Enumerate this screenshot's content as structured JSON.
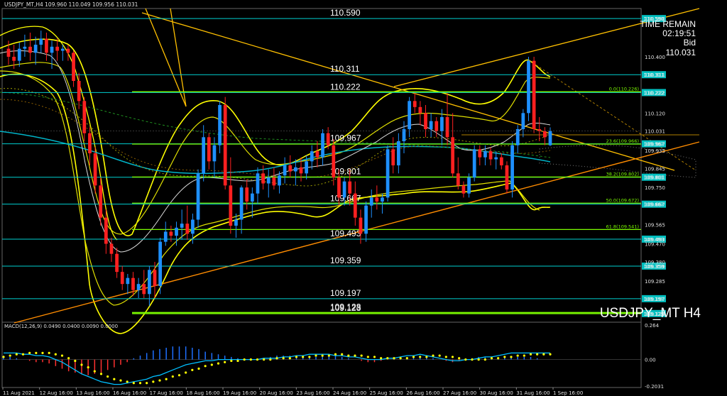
{
  "header": {
    "symbol_line": "USDJPY_MT,H4 109.960 110.049 109.956 110.031"
  },
  "watermark": "USDJPY_MT H4",
  "timer": {
    "label": "TIME REMAIN",
    "value": "02:19:51",
    "bid_label": "Bid",
    "bid_value": "110.031"
  },
  "colors": {
    "bull": "#1e90ff",
    "bear": "#ff2020",
    "hline": "#00cfd0",
    "fib": "#7cfc00",
    "band": "#ffff00",
    "trend": "#ffc000",
    "orange": "#ff8c00",
    "macd_line": "#00bfff",
    "signal": "#ffff00",
    "macd_neg": "#ff3030",
    "macd_pos": "#1e6fff"
  },
  "chart_data": [
    {
      "type": "candlestick",
      "title": "USDJPY_MT,H4",
      "ylim": [
        109.08,
        110.64
      ],
      "y_ticks": [
        "110.590",
        "110.400",
        "110.311",
        "110.222",
        "110.120",
        "110.031",
        "109.935",
        "109.967",
        "109.845",
        "109.801",
        "109.750",
        "109.667",
        "109.565",
        "109.493",
        "109.470",
        "109.380",
        "109.359",
        "109.285",
        "109.197",
        "109.123"
      ],
      "x_ticks": [
        "11 Aug 2021",
        "12 Aug 16:00",
        "13 Aug 16:00",
        "16 Aug 16:00",
        "17 Aug 16:00",
        "18 Aug 16:00",
        "19 Aug 16:00",
        "20 Aug 16:00",
        "23 Aug 16:00",
        "24 Aug 16:00",
        "25 Aug 16:00",
        "26 Aug 16:00",
        "27 Aug 16:00",
        "30 Aug 16:00",
        "31 Aug 16:00",
        "1 Sep 16:00"
      ],
      "horizontal_levels": [
        {
          "label": "110.590",
          "value": 110.59,
          "box": "110.590"
        },
        {
          "label": "110.311",
          "value": 110.311,
          "box": "110.311"
        },
        {
          "label": "110.222",
          "value": 110.222,
          "box": "110.222"
        },
        {
          "label": "109.967",
          "value": 109.967,
          "box": "109.967"
        },
        {
          "label": "109.801",
          "value": 109.801,
          "box": "109.801"
        },
        {
          "label": "109.667",
          "value": 109.667,
          "box": "109.667"
        },
        {
          "label": "109.493",
          "value": 109.493,
          "box": "109.493"
        },
        {
          "label": "109.359",
          "value": 109.359,
          "box": "109.359"
        },
        {
          "label": "109.197",
          "value": 109.197,
          "box": "109.197"
        },
        {
          "label": "109.128",
          "value": 109.128,
          "box": ""
        },
        {
          "label": "109.123",
          "value": 109.123,
          "box": "109.123"
        }
      ],
      "fib_levels": [
        {
          "label": "0.0(110.226)",
          "value": 110.226
        },
        {
          "label": "23.6(109.966)",
          "value": 109.966
        },
        {
          "label": "38.2(109.802)",
          "value": 109.802
        },
        {
          "label": "50.0(109.672)",
          "value": 109.672
        },
        {
          "label": "61.8(109.541)",
          "value": 109.541
        }
      ],
      "candles": [
        {
          "o": 110.44,
          "h": 110.48,
          "l": 110.36,
          "c": 110.4
        },
        {
          "o": 110.4,
          "h": 110.46,
          "l": 110.34,
          "c": 110.38
        },
        {
          "o": 110.38,
          "h": 110.47,
          "l": 110.35,
          "c": 110.44
        },
        {
          "o": 110.44,
          "h": 110.51,
          "l": 110.4,
          "c": 110.45
        },
        {
          "o": 110.45,
          "h": 110.52,
          "l": 110.38,
          "c": 110.42
        },
        {
          "o": 110.42,
          "h": 110.5,
          "l": 110.36,
          "c": 110.46
        },
        {
          "o": 110.46,
          "h": 110.53,
          "l": 110.42,
          "c": 110.49
        },
        {
          "o": 110.49,
          "h": 110.52,
          "l": 110.38,
          "c": 110.42
        },
        {
          "o": 110.42,
          "h": 110.48,
          "l": 110.34,
          "c": 110.45
        },
        {
          "o": 110.45,
          "h": 110.49,
          "l": 110.38,
          "c": 110.43
        },
        {
          "o": 110.43,
          "h": 110.46,
          "l": 110.38,
          "c": 110.44
        },
        {
          "o": 110.44,
          "h": 110.46,
          "l": 110.38,
          "c": 110.42
        },
        {
          "o": 110.42,
          "h": 110.43,
          "l": 110.25,
          "c": 110.28
        },
        {
          "o": 110.28,
          "h": 110.32,
          "l": 110.14,
          "c": 110.18
        },
        {
          "o": 110.18,
          "h": 110.2,
          "l": 109.98,
          "c": 110.02
        },
        {
          "o": 110.02,
          "h": 110.05,
          "l": 109.86,
          "c": 109.92
        },
        {
          "o": 109.92,
          "h": 109.95,
          "l": 109.72,
          "c": 109.76
        },
        {
          "o": 109.76,
          "h": 109.8,
          "l": 109.56,
          "c": 109.6
        },
        {
          "o": 109.6,
          "h": 109.64,
          "l": 109.42,
          "c": 109.47
        },
        {
          "o": 109.47,
          "h": 109.5,
          "l": 109.38,
          "c": 109.42
        },
        {
          "o": 109.42,
          "h": 109.45,
          "l": 109.3,
          "c": 109.33
        },
        {
          "o": 109.33,
          "h": 109.36,
          "l": 109.24,
          "c": 109.27
        },
        {
          "o": 109.27,
          "h": 109.32,
          "l": 109.22,
          "c": 109.3
        },
        {
          "o": 109.3,
          "h": 109.33,
          "l": 109.21,
          "c": 109.24
        },
        {
          "o": 109.24,
          "h": 109.3,
          "l": 109.2,
          "c": 109.27
        },
        {
          "o": 109.27,
          "h": 109.34,
          "l": 109.2,
          "c": 109.22
        },
        {
          "o": 109.22,
          "h": 109.36,
          "l": 109.16,
          "c": 109.34
        },
        {
          "o": 109.34,
          "h": 109.38,
          "l": 109.2,
          "c": 109.26
        },
        {
          "o": 109.26,
          "h": 109.5,
          "l": 109.22,
          "c": 109.48
        },
        {
          "o": 109.48,
          "h": 109.58,
          "l": 109.46,
          "c": 109.53
        },
        {
          "o": 109.53,
          "h": 109.56,
          "l": 109.48,
          "c": 109.51
        },
        {
          "o": 109.51,
          "h": 109.58,
          "l": 109.46,
          "c": 109.55
        },
        {
          "o": 109.55,
          "h": 109.64,
          "l": 109.49,
          "c": 109.57
        },
        {
          "o": 109.57,
          "h": 109.66,
          "l": 109.49,
          "c": 109.52
        },
        {
          "o": 109.52,
          "h": 109.62,
          "l": 109.47,
          "c": 109.59
        },
        {
          "o": 109.59,
          "h": 109.84,
          "l": 109.55,
          "c": 109.82
        },
        {
          "o": 109.82,
          "h": 110.06,
          "l": 109.78,
          "c": 110.0
        },
        {
          "o": 110.0,
          "h": 110.02,
          "l": 109.84,
          "c": 109.88
        },
        {
          "o": 109.88,
          "h": 110.0,
          "l": 109.8,
          "c": 109.96
        },
        {
          "o": 109.96,
          "h": 110.18,
          "l": 109.92,
          "c": 110.16
        },
        {
          "o": 110.16,
          "h": 110.2,
          "l": 109.74,
          "c": 109.76
        },
        {
          "o": 109.76,
          "h": 109.9,
          "l": 109.52,
          "c": 109.56
        },
        {
          "o": 109.56,
          "h": 109.62,
          "l": 109.5,
          "c": 109.59
        },
        {
          "o": 109.59,
          "h": 109.76,
          "l": 109.52,
          "c": 109.75
        },
        {
          "o": 109.75,
          "h": 109.79,
          "l": 109.64,
          "c": 109.68
        },
        {
          "o": 109.68,
          "h": 109.75,
          "l": 109.6,
          "c": 109.72
        },
        {
          "o": 109.72,
          "h": 109.85,
          "l": 109.67,
          "c": 109.82
        },
        {
          "o": 109.82,
          "h": 109.86,
          "l": 109.74,
          "c": 109.77
        },
        {
          "o": 109.77,
          "h": 109.84,
          "l": 109.7,
          "c": 109.8
        },
        {
          "o": 109.8,
          "h": 109.85,
          "l": 109.74,
          "c": 109.76
        },
        {
          "o": 109.76,
          "h": 109.83,
          "l": 109.72,
          "c": 109.81
        },
        {
          "o": 109.81,
          "h": 109.9,
          "l": 109.77,
          "c": 109.86
        },
        {
          "o": 109.86,
          "h": 109.91,
          "l": 109.8,
          "c": 109.83
        },
        {
          "o": 109.83,
          "h": 109.89,
          "l": 109.76,
          "c": 109.85
        },
        {
          "o": 109.85,
          "h": 109.9,
          "l": 109.78,
          "c": 109.82
        },
        {
          "o": 109.82,
          "h": 109.91,
          "l": 109.79,
          "c": 109.88
        },
        {
          "o": 109.88,
          "h": 109.96,
          "l": 109.84,
          "c": 109.93
        },
        {
          "o": 109.93,
          "h": 109.98,
          "l": 109.85,
          "c": 109.9
        },
        {
          "o": 109.9,
          "h": 110.04,
          "l": 109.86,
          "c": 110.02
        },
        {
          "o": 110.02,
          "h": 110.05,
          "l": 109.94,
          "c": 109.96
        },
        {
          "o": 109.96,
          "h": 109.99,
          "l": 109.76,
          "c": 109.8
        },
        {
          "o": 109.8,
          "h": 109.84,
          "l": 109.66,
          "c": 109.7
        },
        {
          "o": 109.7,
          "h": 109.8,
          "l": 109.66,
          "c": 109.78
        },
        {
          "o": 109.78,
          "h": 109.84,
          "l": 109.66,
          "c": 109.72
        },
        {
          "o": 109.72,
          "h": 109.78,
          "l": 109.56,
          "c": 109.6
        },
        {
          "o": 109.6,
          "h": 109.64,
          "l": 109.47,
          "c": 109.52
        },
        {
          "o": 109.52,
          "h": 109.68,
          "l": 109.48,
          "c": 109.66
        },
        {
          "o": 109.66,
          "h": 109.74,
          "l": 109.6,
          "c": 109.7
        },
        {
          "o": 109.7,
          "h": 109.76,
          "l": 109.64,
          "c": 109.68
        },
        {
          "o": 109.68,
          "h": 109.72,
          "l": 109.62,
          "c": 109.7
        },
        {
          "o": 109.7,
          "h": 109.96,
          "l": 109.68,
          "c": 109.94
        },
        {
          "o": 109.94,
          "h": 110.0,
          "l": 109.82,
          "c": 109.86
        },
        {
          "o": 109.86,
          "h": 110.02,
          "l": 109.82,
          "c": 109.98
        },
        {
          "o": 109.98,
          "h": 110.08,
          "l": 109.92,
          "c": 110.04
        },
        {
          "o": 110.04,
          "h": 110.2,
          "l": 110.0,
          "c": 110.18
        },
        {
          "o": 110.18,
          "h": 110.22,
          "l": 110.12,
          "c": 110.15
        },
        {
          "o": 110.15,
          "h": 110.18,
          "l": 110.06,
          "c": 110.12
        },
        {
          "o": 110.12,
          "h": 110.16,
          "l": 110.0,
          "c": 110.04
        },
        {
          "o": 110.04,
          "h": 110.12,
          "l": 110.0,
          "c": 110.08
        },
        {
          "o": 110.08,
          "h": 110.1,
          "l": 110.0,
          "c": 110.03
        },
        {
          "o": 110.03,
          "h": 110.14,
          "l": 109.96,
          "c": 110.1
        },
        {
          "o": 110.1,
          "h": 110.22,
          "l": 109.96,
          "c": 110.0
        },
        {
          "o": 110.0,
          "h": 110.12,
          "l": 109.8,
          "c": 109.82
        },
        {
          "o": 109.82,
          "h": 109.9,
          "l": 109.74,
          "c": 109.76
        },
        {
          "o": 109.76,
          "h": 109.78,
          "l": 109.7,
          "c": 109.72
        },
        {
          "o": 109.72,
          "h": 109.82,
          "l": 109.7,
          "c": 109.8
        },
        {
          "o": 109.8,
          "h": 109.96,
          "l": 109.78,
          "c": 109.94
        },
        {
          "o": 109.94,
          "h": 109.96,
          "l": 109.86,
          "c": 109.9
        },
        {
          "o": 109.9,
          "h": 109.96,
          "l": 109.86,
          "c": 109.93
        },
        {
          "o": 109.93,
          "h": 109.95,
          "l": 109.86,
          "c": 109.89
        },
        {
          "o": 109.89,
          "h": 109.93,
          "l": 109.84,
          "c": 109.9
        },
        {
          "o": 109.9,
          "h": 109.92,
          "l": 109.84,
          "c": 109.86
        },
        {
          "o": 109.86,
          "h": 109.88,
          "l": 109.72,
          "c": 109.74
        },
        {
          "o": 109.74,
          "h": 109.98,
          "l": 109.7,
          "c": 109.96
        },
        {
          "o": 109.96,
          "h": 110.06,
          "l": 109.92,
          "c": 110.04
        },
        {
          "o": 110.04,
          "h": 110.14,
          "l": 110.0,
          "c": 110.12
        },
        {
          "o": 110.12,
          "h": 110.4,
          "l": 110.08,
          "c": 110.38
        },
        {
          "o": 110.38,
          "h": 110.4,
          "l": 110.02,
          "c": 110.04
        },
        {
          "o": 110.04,
          "h": 110.1,
          "l": 109.98,
          "c": 110.03
        },
        {
          "o": 110.03,
          "h": 110.05,
          "l": 109.96,
          "c": 110.0
        },
        {
          "o": 109.96,
          "h": 110.049,
          "l": 109.956,
          "c": 110.031
        }
      ]
    },
    {
      "type": "bar",
      "title": "MACD(12,26,9) 0.0490 0.0400 0.0090 0.0000",
      "ylim": [
        -0.2031,
        0.264
      ],
      "y_ticks": [
        "0.264",
        "0.00",
        "-0.2031"
      ],
      "series": [
        {
          "name": "histogram",
          "values": [
            0.03,
            0.02,
            0.01,
            0.0,
            -0.01,
            -0.02,
            -0.02,
            -0.03,
            -0.05,
            -0.07,
            -0.09,
            -0.1,
            -0.11,
            -0.12,
            -0.11,
            -0.1,
            -0.08,
            -0.06,
            -0.04,
            -0.02,
            0.01,
            0.03,
            0.05,
            0.07,
            0.08,
            0.09,
            0.1,
            0.1,
            0.1,
            0.09,
            0.08,
            0.06,
            0.05,
            0.04,
            0.03,
            0.02,
            0.01,
            0.0,
            0.0,
            0.0,
            0.01,
            0.02,
            0.03,
            0.03,
            0.03,
            0.02,
            0.02,
            0.02,
            0.02,
            0.03,
            0.04,
            0.03,
            0.02,
            0.01,
            0.0,
            -0.01,
            -0.02,
            -0.02,
            -0.01,
            0.0,
            0.01,
            0.02,
            0.02,
            0.03,
            0.03,
            0.02,
            0.01,
            0.0,
            -0.01,
            -0.02,
            -0.01,
            0.0,
            0.01,
            0.02,
            0.02,
            0.01,
            0.01,
            0.02,
            0.02,
            0.02,
            0.02,
            0.02,
            0.01,
            0.0,
            0.0
          ]
        },
        {
          "name": "macd",
          "values": [
            0.05,
            0.05,
            0.05,
            0.04,
            0.04,
            0.03,
            0.03,
            0.02,
            0.0,
            -0.02,
            -0.05,
            -0.08,
            -0.11,
            -0.13,
            -0.15,
            -0.17,
            -0.18,
            -0.19,
            -0.19,
            -0.18,
            -0.17,
            -0.16,
            -0.15,
            -0.13,
            -0.12,
            -0.1,
            -0.08,
            -0.06,
            -0.04,
            -0.03,
            -0.02,
            -0.01,
            -0.01,
            0.0,
            0.0,
            0.0,
            0.0,
            0.0,
            0.0,
            0.0,
            0.01,
            0.01,
            0.01,
            0.02,
            0.02,
            0.03,
            0.03,
            0.04,
            0.04,
            0.04,
            0.04,
            0.03,
            0.03,
            0.02,
            0.02,
            0.01,
            0.0,
            0.0,
            0.0,
            0.01,
            0.01,
            0.02,
            0.03,
            0.03,
            0.04,
            0.03,
            0.02,
            0.01,
            0.0,
            -0.01,
            -0.01,
            0.0,
            0.0,
            0.01,
            0.02,
            0.02,
            0.03,
            0.04,
            0.05,
            0.05,
            0.05,
            0.05,
            0.05,
            0.05,
            0.05
          ]
        },
        {
          "name": "signal",
          "values": [
            0.02,
            0.03,
            0.04,
            0.04,
            0.05,
            0.05,
            0.05,
            0.05,
            0.04,
            0.03,
            0.01,
            -0.01,
            -0.04,
            -0.06,
            -0.09,
            -0.11,
            -0.13,
            -0.15,
            -0.16,
            -0.17,
            -0.18,
            -0.18,
            -0.18,
            -0.17,
            -0.16,
            -0.15,
            -0.13,
            -0.12,
            -0.1,
            -0.08,
            -0.07,
            -0.05,
            -0.04,
            -0.03,
            -0.02,
            -0.01,
            -0.01,
            0.0,
            0.0,
            0.0,
            0.0,
            0.0,
            0.01,
            0.01,
            0.01,
            0.02,
            0.02,
            0.02,
            0.03,
            0.03,
            0.03,
            0.04,
            0.04,
            0.03,
            0.03,
            0.03,
            0.02,
            0.02,
            0.01,
            0.01,
            0.01,
            0.01,
            0.01,
            0.02,
            0.02,
            0.02,
            0.03,
            0.03,
            0.02,
            0.02,
            0.01,
            0.0,
            0.0,
            0.0,
            0.0,
            0.01,
            0.01,
            0.02,
            0.02,
            0.03,
            0.03,
            0.04,
            0.04,
            0.04,
            0.04
          ]
        }
      ]
    }
  ]
}
